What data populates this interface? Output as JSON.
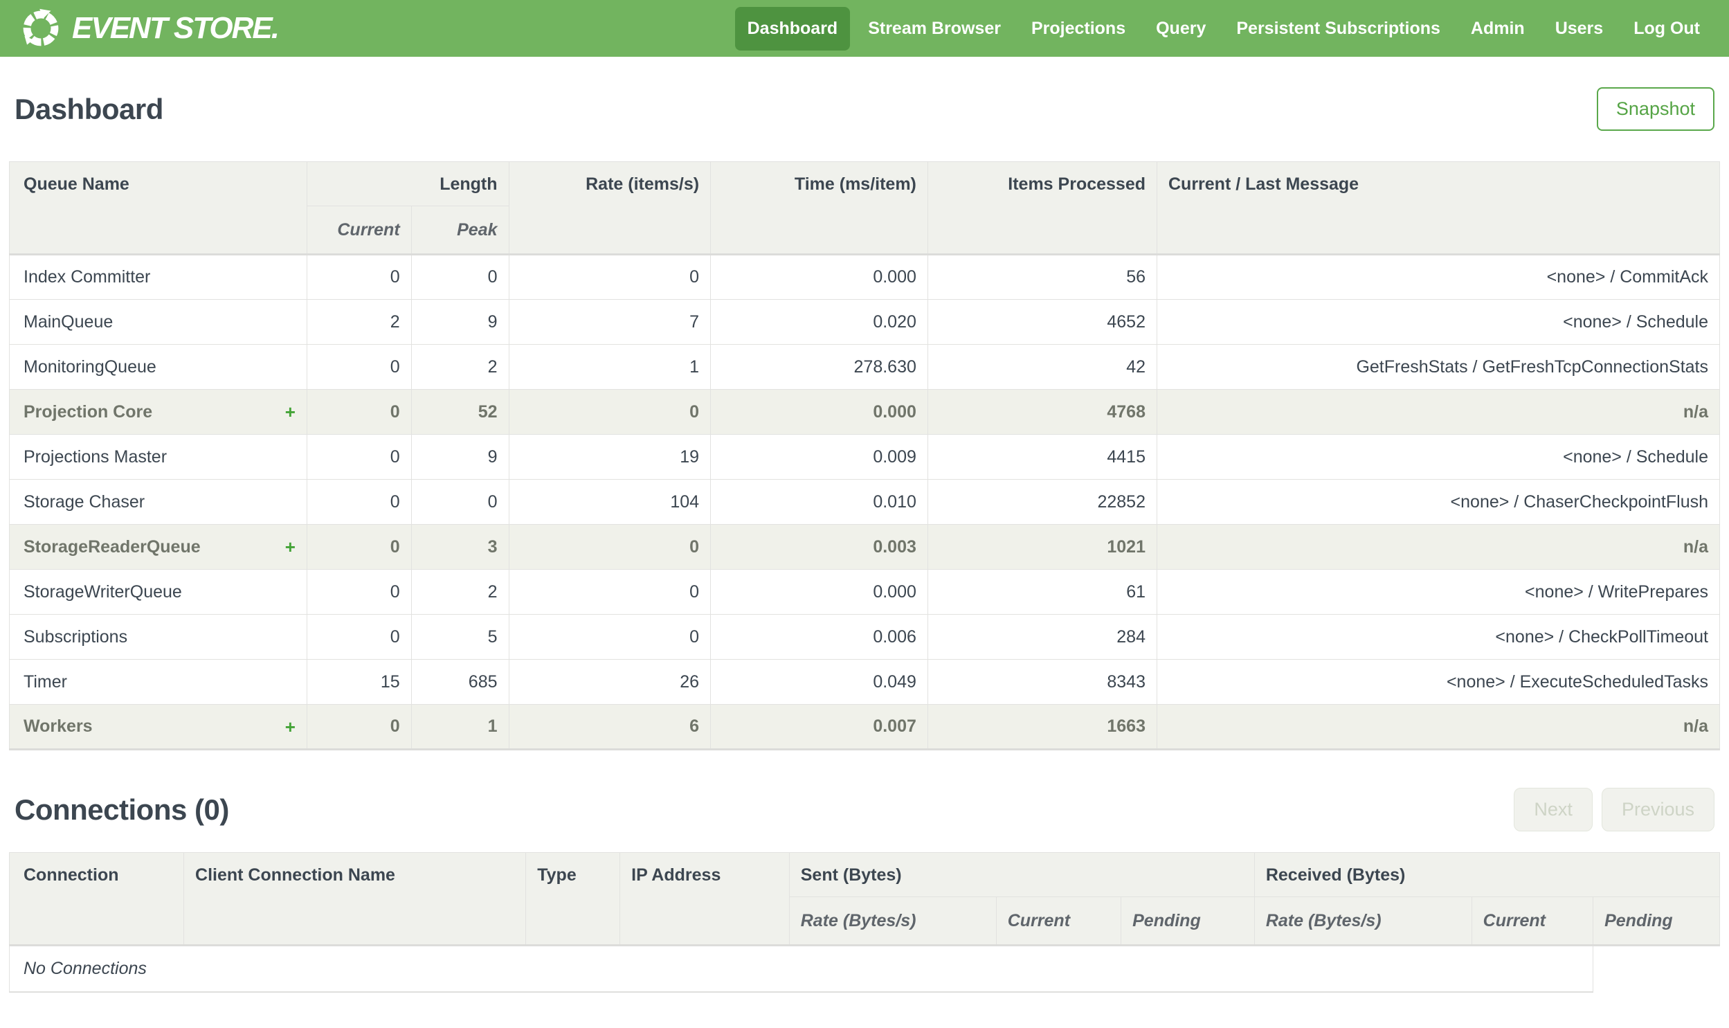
{
  "navbar": {
    "logo_text": "EVENT STORE.",
    "items": [
      {
        "label": "Dashboard",
        "active": true
      },
      {
        "label": "Stream Browser",
        "active": false
      },
      {
        "label": "Projections",
        "active": false
      },
      {
        "label": "Query",
        "active": false
      },
      {
        "label": "Persistent Subscriptions",
        "active": false
      },
      {
        "label": "Admin",
        "active": false
      },
      {
        "label": "Users",
        "active": false
      },
      {
        "label": "Log Out",
        "active": false
      }
    ]
  },
  "page": {
    "title": "Dashboard",
    "snapshot_label": "Snapshot"
  },
  "queues": {
    "headers": {
      "queue_name": "Queue Name",
      "length": "Length",
      "current": "Current",
      "peak": "Peak",
      "rate": "Rate (items/s)",
      "time": "Time (ms/item)",
      "items_processed": "Items Processed",
      "message": "Current / Last Message"
    },
    "rows": [
      {
        "name": "Index Committer",
        "expand": "",
        "current": "0",
        "peak": "0",
        "rate": "0",
        "time": "0.000",
        "items": "56",
        "message": "<none> / CommitAck"
      },
      {
        "name": "MainQueue",
        "expand": "",
        "current": "2",
        "peak": "9",
        "rate": "7",
        "time": "0.020",
        "items": "4652",
        "message": "<none> / Schedule"
      },
      {
        "name": "MonitoringQueue",
        "expand": "",
        "current": "0",
        "peak": "2",
        "rate": "1",
        "time": "278.630",
        "items": "42",
        "message": "GetFreshStats / GetFreshTcpConnectionStats"
      },
      {
        "name": "Projection Core",
        "expand": "+",
        "current": "0",
        "peak": "52",
        "rate": "0",
        "time": "0.000",
        "items": "4768",
        "message": "n/a"
      },
      {
        "name": "Projections Master",
        "expand": "",
        "current": "0",
        "peak": "9",
        "rate": "19",
        "time": "0.009",
        "items": "4415",
        "message": "<none> / Schedule"
      },
      {
        "name": "Storage Chaser",
        "expand": "",
        "current": "0",
        "peak": "0",
        "rate": "104",
        "time": "0.010",
        "items": "22852",
        "message": "<none> / ChaserCheckpointFlush"
      },
      {
        "name": "StorageReaderQueue",
        "expand": "+",
        "current": "0",
        "peak": "3",
        "rate": "0",
        "time": "0.003",
        "items": "1021",
        "message": "n/a"
      },
      {
        "name": "StorageWriterQueue",
        "expand": "",
        "current": "0",
        "peak": "2",
        "rate": "0",
        "time": "0.000",
        "items": "61",
        "message": "<none> / WritePrepares"
      },
      {
        "name": "Subscriptions",
        "expand": "",
        "current": "0",
        "peak": "5",
        "rate": "0",
        "time": "0.006",
        "items": "284",
        "message": "<none> / CheckPollTimeout"
      },
      {
        "name": "Timer",
        "expand": "",
        "current": "15",
        "peak": "685",
        "rate": "26",
        "time": "0.049",
        "items": "8343",
        "message": "<none> / ExecuteScheduledTasks"
      },
      {
        "name": "Workers",
        "expand": "+",
        "current": "0",
        "peak": "1",
        "rate": "6",
        "time": "0.007",
        "items": "1663",
        "message": "n/a"
      }
    ]
  },
  "connections": {
    "title": "Connections (0)",
    "pager": {
      "next": "Next",
      "previous": "Previous"
    },
    "headers": {
      "connection": "Connection",
      "client_name": "Client Connection Name",
      "type": "Type",
      "ip": "IP Address",
      "sent": "Sent (Bytes)",
      "received": "Received (Bytes)",
      "rate_bytes": "Rate (Bytes/s)",
      "current": "Current",
      "pending": "Pending"
    },
    "empty_message": "No Connections"
  },
  "colors": {
    "navbar_green": "#72b45f",
    "active_nav_green": "#4e9340",
    "accent_green": "#55a445",
    "plus_green": "#43a336",
    "header_bg": "#f0f1ec",
    "text_slate": "#3c4650",
    "group_text": "#70756a"
  }
}
